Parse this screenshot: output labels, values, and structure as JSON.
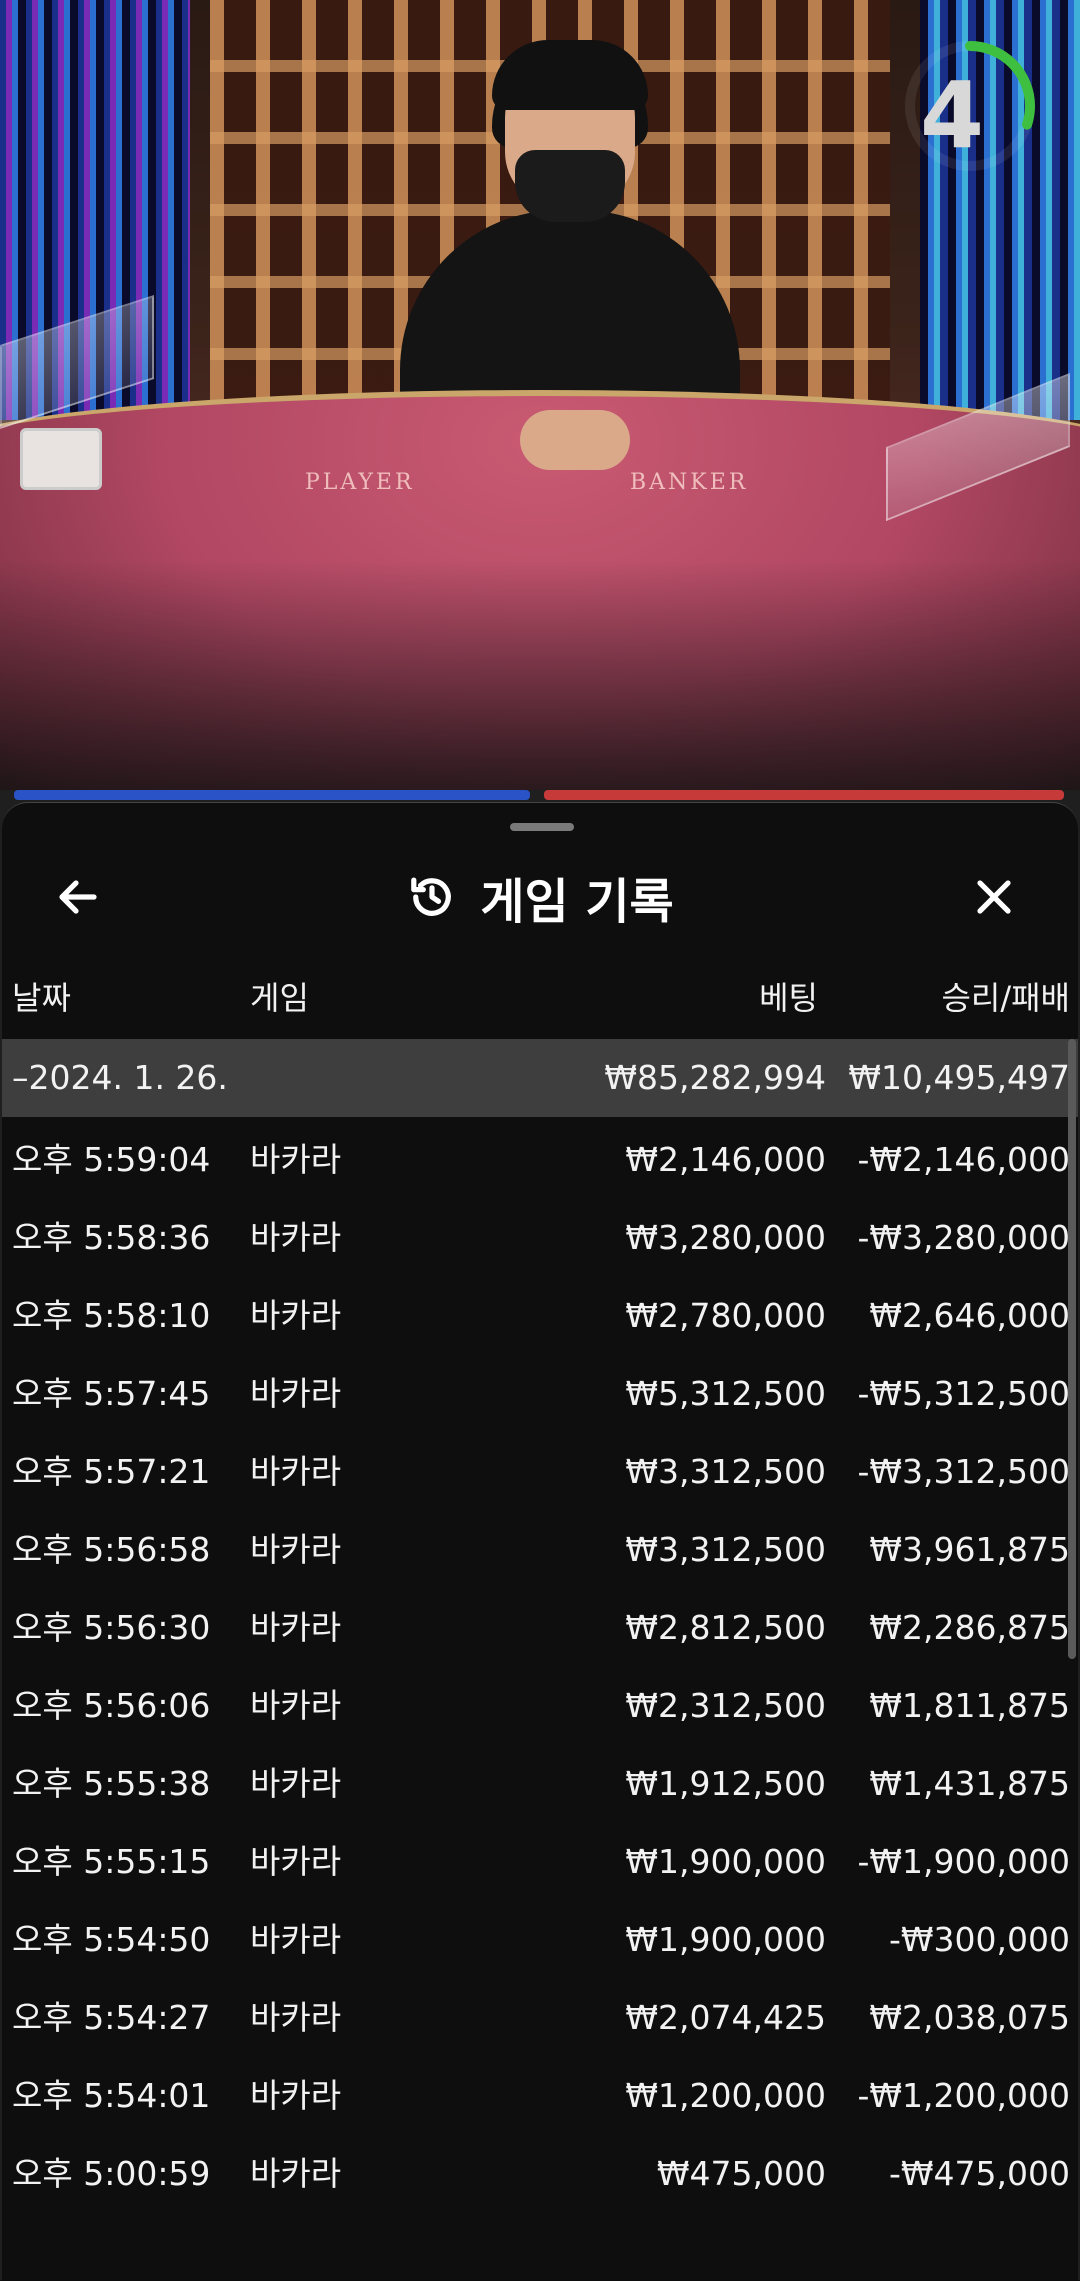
{
  "video": {
    "felt_left_label": "PLAYER",
    "felt_right_label": "BANKER",
    "timer_value": "4",
    "timer_progress": 0.3
  },
  "colors": {
    "player_blue": "#2953c6",
    "banker_red": "#c63a3a",
    "timer_green": "#3fbf3f"
  },
  "header": {
    "title": "게임 기록",
    "title_icon": "history-icon",
    "back_icon": "arrow-left-icon",
    "close_icon": "close-icon"
  },
  "columns": {
    "date": "날짜",
    "game": "게임",
    "bet": "베팅",
    "result": "승리/패배"
  },
  "date_group": {
    "date": "–2024. 1. 26.",
    "total_bet": "₩85,282,994",
    "total_result": "₩10,495,497"
  },
  "rows": [
    {
      "time": "오후 5:59:04",
      "game": "바카라",
      "bet": "₩2,146,000",
      "result": "-₩2,146,000"
    },
    {
      "time": "오후 5:58:36",
      "game": "바카라",
      "bet": "₩3,280,000",
      "result": "-₩3,280,000"
    },
    {
      "time": "오후 5:58:10",
      "game": "바카라",
      "bet": "₩2,780,000",
      "result": "₩2,646,000"
    },
    {
      "time": "오후 5:57:45",
      "game": "바카라",
      "bet": "₩5,312,500",
      "result": "-₩5,312,500"
    },
    {
      "time": "오후 5:57:21",
      "game": "바카라",
      "bet": "₩3,312,500",
      "result": "-₩3,312,500"
    },
    {
      "time": "오후 5:56:58",
      "game": "바카라",
      "bet": "₩3,312,500",
      "result": "₩3,961,875"
    },
    {
      "time": "오후 5:56:30",
      "game": "바카라",
      "bet": "₩2,812,500",
      "result": "₩2,286,875"
    },
    {
      "time": "오후 5:56:06",
      "game": "바카라",
      "bet": "₩2,312,500",
      "result": "₩1,811,875"
    },
    {
      "time": "오후 5:55:38",
      "game": "바카라",
      "bet": "₩1,912,500",
      "result": "₩1,431,875"
    },
    {
      "time": "오후 5:55:15",
      "game": "바카라",
      "bet": "₩1,900,000",
      "result": "-₩1,900,000"
    },
    {
      "time": "오후 5:54:50",
      "game": "바카라",
      "bet": "₩1,900,000",
      "result": "-₩300,000"
    },
    {
      "time": "오후 5:54:27",
      "game": "바카라",
      "bet": "₩2,074,425",
      "result": "₩2,038,075"
    },
    {
      "time": "오후 5:54:01",
      "game": "바카라",
      "bet": "₩1,200,000",
      "result": "-₩1,200,000"
    },
    {
      "time": "오후 5:00:59",
      "game": "바카라",
      "bet": "₩475,000",
      "result": "-₩475,000"
    }
  ]
}
